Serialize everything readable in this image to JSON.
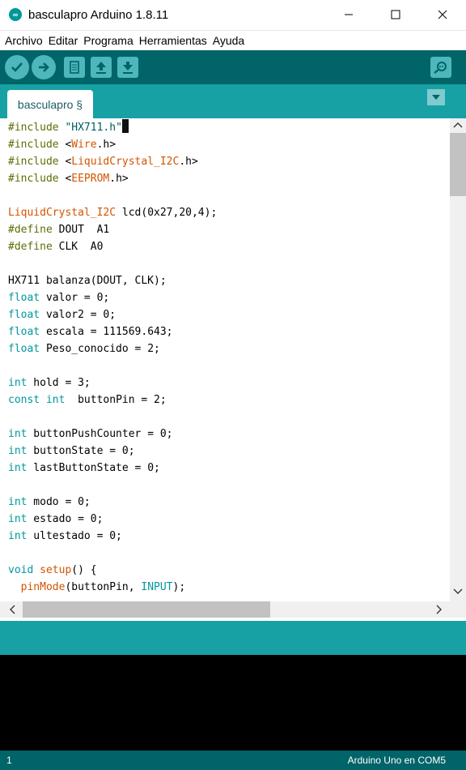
{
  "window": {
    "title": "basculapro Arduino 1.8.11",
    "app_icon": "infinity-icon",
    "controls": [
      "minimize-icon",
      "maximize-icon",
      "close-icon"
    ]
  },
  "menu": [
    "Archivo",
    "Editar",
    "Programa",
    "Herramientas",
    "Ayuda"
  ],
  "toolbar": {
    "buttons": [
      "verify-icon",
      "upload-icon",
      "new-icon",
      "open-icon",
      "save-icon"
    ],
    "serial_monitor": "serial-monitor-icon"
  },
  "tab": {
    "label": "basculapro §"
  },
  "colors": {
    "toolbar": "#006468",
    "tabbar": "#17a1a5",
    "keyword": "#00979c",
    "preprocessor": "#5e6d03",
    "class": "#d35400",
    "string": "#005c5f"
  },
  "code": [
    [
      [
        "pp",
        "#include"
      ],
      [
        "t",
        " "
      ],
      [
        "str",
        "\"HX711.h\""
      ],
      [
        "cursor",
        ""
      ]
    ],
    [
      [
        "pp",
        "#include"
      ],
      [
        "t",
        " <"
      ],
      [
        "type",
        "Wire"
      ],
      [
        "t",
        ".h>"
      ]
    ],
    [
      [
        "pp",
        "#include"
      ],
      [
        "t",
        " <"
      ],
      [
        "type",
        "LiquidCrystal_I2C"
      ],
      [
        "t",
        ".h>"
      ]
    ],
    [
      [
        "pp",
        "#include"
      ],
      [
        "t",
        " <"
      ],
      [
        "type",
        "EEPROM"
      ],
      [
        "t",
        ".h>"
      ]
    ],
    [],
    [
      [
        "type",
        "LiquidCrystal_I2C"
      ],
      [
        "t",
        " lcd(0x27,20,4);"
      ]
    ],
    [
      [
        "pp",
        "#define"
      ],
      [
        "t",
        " DOUT  A1"
      ]
    ],
    [
      [
        "pp",
        "#define"
      ],
      [
        "t",
        " CLK  A0"
      ]
    ],
    [],
    [
      [
        "t",
        "HX711 balanza(DOUT, CLK);"
      ]
    ],
    [
      [
        "kw",
        "float"
      ],
      [
        "t",
        " valor = 0;"
      ]
    ],
    [
      [
        "kw",
        "float"
      ],
      [
        "t",
        " valor2 = 0;"
      ]
    ],
    [
      [
        "kw",
        "float"
      ],
      [
        "t",
        " escala = 111569.643;"
      ]
    ],
    [
      [
        "kw",
        "float"
      ],
      [
        "t",
        " Peso_conocido = 2;"
      ]
    ],
    [],
    [
      [
        "kw",
        "int"
      ],
      [
        "t",
        " hold = 3;"
      ]
    ],
    [
      [
        "kw",
        "const"
      ],
      [
        "t",
        " "
      ],
      [
        "kw",
        "int"
      ],
      [
        "t",
        "  buttonPin = 2;"
      ]
    ],
    [],
    [
      [
        "kw",
        "int"
      ],
      [
        "t",
        " buttonPushCounter = 0;"
      ]
    ],
    [
      [
        "kw",
        "int"
      ],
      [
        "t",
        " buttonState = 0;"
      ]
    ],
    [
      [
        "kw",
        "int"
      ],
      [
        "t",
        " lastButtonState = 0;"
      ]
    ],
    [],
    [
      [
        "kw",
        "int"
      ],
      [
        "t",
        " modo = 0;"
      ]
    ],
    [
      [
        "kw",
        "int"
      ],
      [
        "t",
        " estado = 0;"
      ]
    ],
    [
      [
        "kw",
        "int"
      ],
      [
        "t",
        " ultestado = 0;"
      ]
    ],
    [],
    [
      [
        "kw",
        "void"
      ],
      [
        "t",
        " "
      ],
      [
        "fn",
        "setup"
      ],
      [
        "t",
        "() {"
      ]
    ],
    [
      [
        "t",
        "  "
      ],
      [
        "fn",
        "pinMode"
      ],
      [
        "t",
        "(buttonPin, "
      ],
      [
        "kw",
        "INPUT"
      ],
      [
        "t",
        ");"
      ]
    ]
  ],
  "status": {
    "line": "1",
    "board": "Arduino Uno en COM5"
  }
}
